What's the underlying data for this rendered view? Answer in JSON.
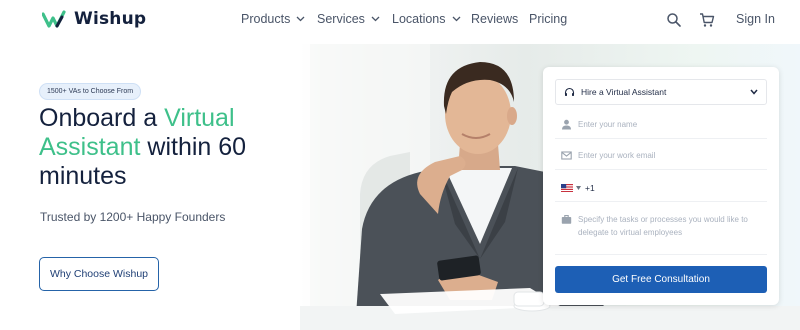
{
  "brand": {
    "name": "Wishup"
  },
  "nav": {
    "items": [
      {
        "label": "Products",
        "has_dropdown": true
      },
      {
        "label": "Services",
        "has_dropdown": true
      },
      {
        "label": "Locations",
        "has_dropdown": true
      },
      {
        "label": "Reviews",
        "has_dropdown": false
      },
      {
        "label": "Pricing",
        "has_dropdown": false
      }
    ],
    "icons": [
      "search-icon",
      "cart-icon"
    ],
    "signin_label": "Sign In"
  },
  "hero": {
    "badge": "1500+ VAs to Choose From",
    "headline": {
      "part1": "Onboard a ",
      "accent": "Virtual Assistant",
      "part2": " within 60 minutes"
    },
    "subtext": "Trusted by 1200+ Happy Founders",
    "cta_label": "Why Choose Wishup"
  },
  "form": {
    "service_select": {
      "value": "Hire a Virtual Assistant",
      "icon": "headset-icon"
    },
    "name": {
      "placeholder": "Enter your name",
      "icon": "user-icon"
    },
    "email": {
      "placeholder": "Enter your work email",
      "icon": "mail-icon"
    },
    "phone": {
      "country_code": "+1",
      "flag": "us-flag-icon"
    },
    "tasks": {
      "placeholder": "Specify the tasks or processes you would like to delegate to virtual employees",
      "icon": "briefcase-icon"
    },
    "submit_label": "Get Free Consultation"
  },
  "colors": {
    "accent_green": "#3ec08a",
    "primary_blue": "#1d5fb5",
    "heading_navy": "#14213d"
  }
}
